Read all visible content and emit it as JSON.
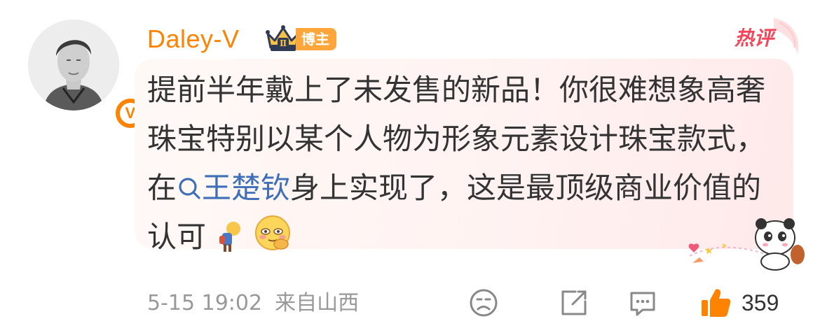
{
  "comment": {
    "username": "Daley-V",
    "badge_level": "Ⅱ",
    "role_tag": "博主",
    "hot_label": "热评",
    "text_before": "提前半年戴上了未发售的新品！你很难想象高奢珠宝特别以某个人物为形象元素设计珠宝款式，在",
    "topic": "王楚钦",
    "text_after": "身上实现了，这是最顶级商业价值的认可",
    "verified_mark": "V",
    "date": "5-15 19:02",
    "source": "来自山西",
    "like_count": "359"
  },
  "icons": {
    "avatar": "user-avatar-photo",
    "verified": "verified-v-badge",
    "crown": "crown-level-icon",
    "hot": "hot-comment-tag",
    "search": "search-icon",
    "emoji1": "person-pondering-emoji",
    "emoji2": "blushing-hand-chin-emoji",
    "dislike": "dislike-face-icon",
    "share": "share-icon",
    "comment": "comment-icon",
    "like": "thumbs-up-icon"
  },
  "colors": {
    "username": "#ff8200",
    "topic": "#3e6fb7",
    "like": "#ff8200",
    "hot": "#f5455a"
  }
}
